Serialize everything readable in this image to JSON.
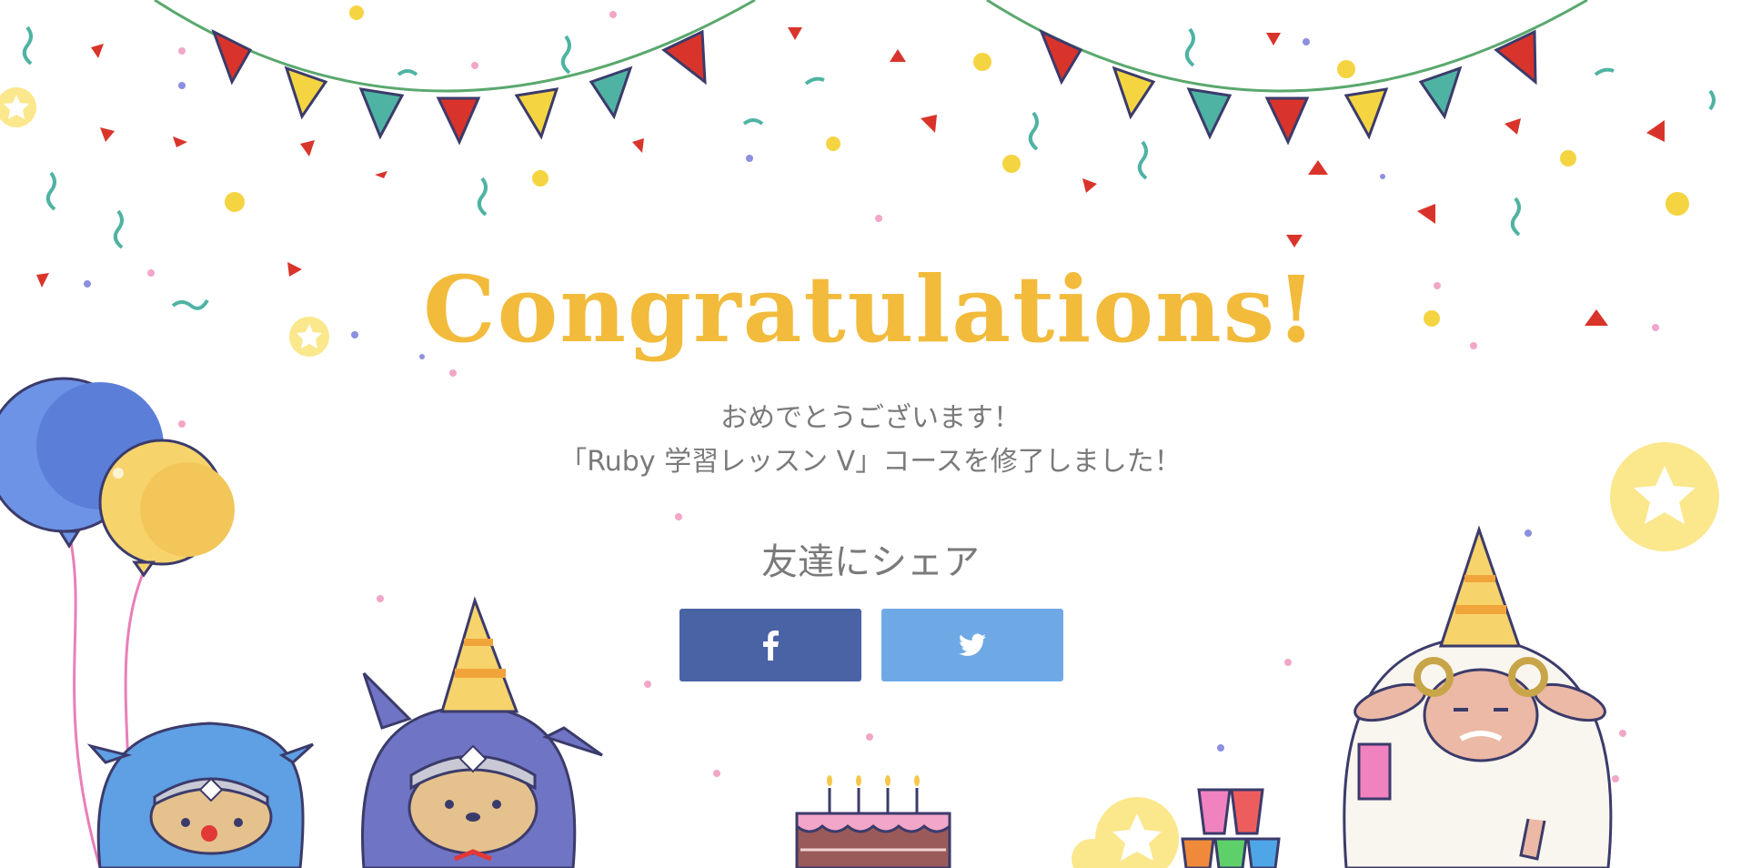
{
  "hero": {
    "title": "Congratulations!",
    "message_line1": "おめでとうございます！",
    "message_line2": "「Ruby 学習レッスン V」コースを修了しました！"
  },
  "share": {
    "heading": "友達にシェア",
    "buttons": [
      {
        "network": "facebook",
        "icon": "facebook-icon",
        "color": "#4963a5"
      },
      {
        "network": "twitter",
        "icon": "twitter-icon",
        "color": "#6ea9e6"
      }
    ]
  },
  "colors": {
    "title": "#f2bb3c",
    "text": "#7a7a7a",
    "flag_red": "#d9342b",
    "flag_yellow": "#f5d442",
    "flag_teal": "#4fb3a3"
  }
}
